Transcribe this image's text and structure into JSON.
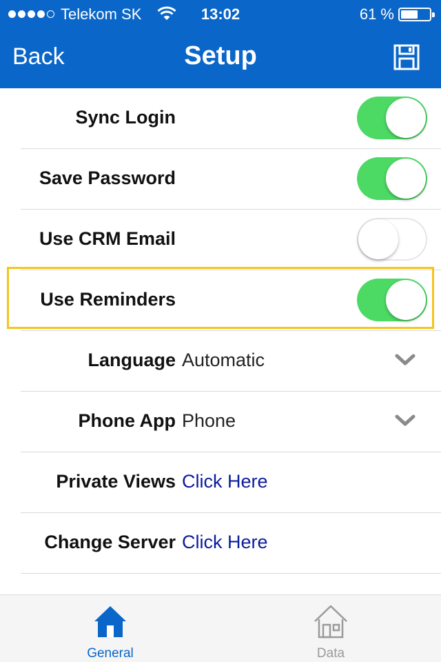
{
  "status_bar": {
    "carrier": "Telekom SK",
    "time": "13:02",
    "battery": "61 %",
    "battery_level": 0.61,
    "signal_bars": 4,
    "signal_max": 5
  },
  "nav": {
    "back_label": "Back",
    "title": "Setup",
    "save_icon": "floppy-disk-icon"
  },
  "settings": {
    "sync_login": {
      "label": "Sync Login",
      "on": true
    },
    "save_password": {
      "label": "Save Password",
      "on": true
    },
    "use_crm_email": {
      "label": "Use CRM Email",
      "on": false
    },
    "use_reminders": {
      "label": "Use Reminders",
      "on": true,
      "highlighted": true
    },
    "language": {
      "label": "Language",
      "value": "Automatic"
    },
    "phone_app": {
      "label": "Phone App",
      "value": "Phone"
    },
    "private_views": {
      "label": "Private Views",
      "link": "Click Here"
    },
    "change_server": {
      "label": "Change Server",
      "link": "Click Here"
    }
  },
  "tabs": [
    {
      "label": "General",
      "icon": "home-icon",
      "active": true
    },
    {
      "label": "Data",
      "icon": "home-icon",
      "active": false
    }
  ],
  "colors": {
    "brand": "#0a66c8",
    "toggle_on": "#4cd964",
    "link": "#0b1b9c",
    "highlight": "#f5c518"
  }
}
